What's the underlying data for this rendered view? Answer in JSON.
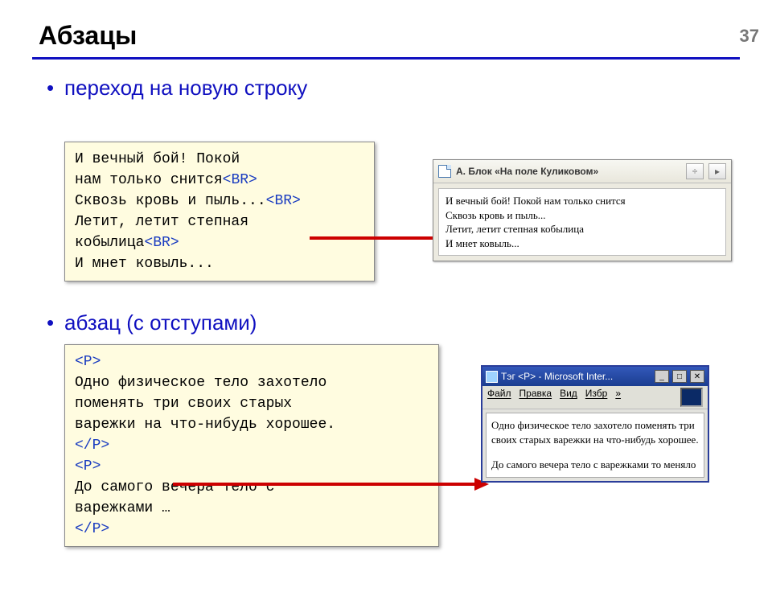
{
  "slide": {
    "number": "37",
    "title": "Абзацы"
  },
  "bullets": {
    "b1": "переход на новую строку",
    "b2": "абзац (с отступами)"
  },
  "code1": {
    "l1": "И вечный бой! Покой",
    "l2a": "нам только снится",
    "l2tag": "<BR>",
    "l3a": "Сквозь кровь и пыль...",
    "l3tag": "<BR>",
    "l4": "Летит, летит степная",
    "l5a": "кобылица",
    "l5tag": "<BR>",
    "l6": "И мнет ковыль..."
  },
  "browser1": {
    "title": "А. Блок  «На поле Куликовом»",
    "body_l1": "И вечный бой! Покой нам только снится",
    "body_l2": "Сквозь кровь и пыль...",
    "body_l3": "Летит, летит степная кобылица",
    "body_l4": "И мнет ковыль..."
  },
  "code2": {
    "t1": "<P>",
    "p1": "Одно физическое тело захотело\nпоменять три своих старых\nварежки на что-нибудь хорошее.",
    "c1": "</P>",
    "t2": "<P>",
    "p2": "До самого вечера тело с\nварежками …",
    "c2": "</P>"
  },
  "browser2": {
    "title": "Тэг <P> - Microsoft Inter...",
    "menu": {
      "file": "Файл",
      "edit": "Правка",
      "view": "Вид",
      "fav": "Избр",
      "more": "»"
    },
    "body_p1": "Одно физическое тело захотело поменять три своих старых варежки на что-нибудь хорошее.",
    "body_p2": "До самого вечера тело с варежками то меняло"
  }
}
